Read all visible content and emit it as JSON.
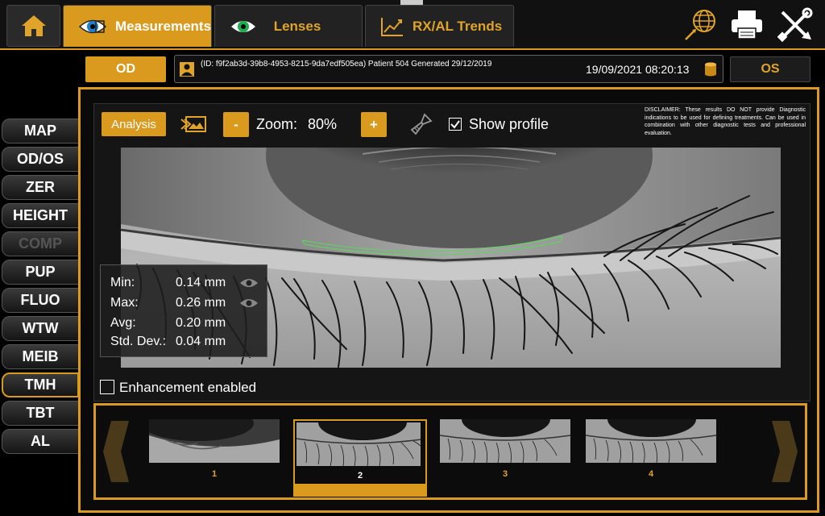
{
  "nav": {
    "home_icon": "home-icon",
    "tabs": [
      {
        "label": "Measurements",
        "icon": "eye-measure-icon",
        "active": true
      },
      {
        "label": "Lenses",
        "icon": "lens-icon",
        "active": false
      },
      {
        "label": "RX/AL Trends",
        "icon": "trend-chart-icon",
        "active": false
      }
    ],
    "tools": [
      "globe-icon",
      "printer-icon",
      "settings-tools-icon"
    ]
  },
  "patient": {
    "left_eye_button": "OD",
    "right_eye_button": "OS",
    "info": "(ID: f9f2ab3d-39b8-4953-8215-9da7edf505ea) Patient 504 Generated 29/12/2019",
    "datetime": "19/09/2021 08:20:13"
  },
  "side_menu": {
    "items": [
      {
        "label": "MAP",
        "state": "normal"
      },
      {
        "label": "OD/OS",
        "state": "normal"
      },
      {
        "label": "ZER",
        "state": "normal"
      },
      {
        "label": "HEIGHT",
        "state": "normal"
      },
      {
        "label": "COMP",
        "state": "disabled"
      },
      {
        "label": "PUP",
        "state": "normal"
      },
      {
        "label": "FLUO",
        "state": "normal"
      },
      {
        "label": "WTW",
        "state": "normal"
      },
      {
        "label": "MEIB",
        "state": "normal"
      },
      {
        "label": "TMH",
        "state": "active"
      },
      {
        "label": "TBT",
        "state": "normal"
      },
      {
        "label": "AL",
        "state": "normal"
      }
    ]
  },
  "toolbar": {
    "analysis_label": "Analysis",
    "zoom_minus": "-",
    "zoom_plus": "+",
    "zoom_label": "Zoom:",
    "zoom_value": "80%",
    "show_profile_label": "Show profile",
    "show_profile_checked": true
  },
  "disclaimer": "DISCLAIMER: These results DO NOT provide Diagnostic indications to be used for defining treatments. Can be used in combination with other diagnostic tests and professional evaluation.",
  "stats": [
    {
      "label": "Min:",
      "value": "0.14 mm",
      "has_eye": true
    },
    {
      "label": "Max:",
      "value": "0.26 mm",
      "has_eye": true
    },
    {
      "label": "Avg:",
      "value": "0.20 mm",
      "has_eye": false
    },
    {
      "label": "Std. Dev.:",
      "value": "0.04 mm",
      "has_eye": false
    }
  ],
  "enhancement": {
    "label": "Enhancement enabled",
    "checked": false
  },
  "thumbnails": [
    {
      "number": "1",
      "selected": false
    },
    {
      "number": "2",
      "selected": true
    },
    {
      "number": "3",
      "selected": false
    },
    {
      "number": "4",
      "selected": false
    }
  ],
  "colors": {
    "accent": "#d99a1e",
    "profile_line": "#5fd35f"
  }
}
